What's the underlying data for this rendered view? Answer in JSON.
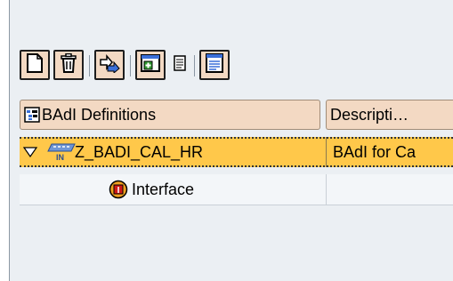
{
  "toolbar": {
    "buttons": [
      {
        "icon": "new-document-icon"
      },
      {
        "icon": "trash-icon"
      },
      {
        "icon": "move-arrows-icon"
      },
      {
        "icon": "add-window-icon"
      },
      {
        "icon": "small-document-icon"
      },
      {
        "icon": "list-document-icon"
      }
    ]
  },
  "table": {
    "columns": [
      "BAdI Definitions",
      "Descripti…"
    ],
    "rows": [
      {
        "name": "Z_BADI_CAL_HR",
        "description": "BAdI for Ca",
        "badge": "IN",
        "selected": true
      },
      {
        "name": "Interface",
        "description": "",
        "icon_letter": "I"
      }
    ]
  },
  "colors": {
    "selected_row": "#ffc84a",
    "header_bg": "#f3d9c3",
    "panel_bg": "#ebeff3"
  }
}
